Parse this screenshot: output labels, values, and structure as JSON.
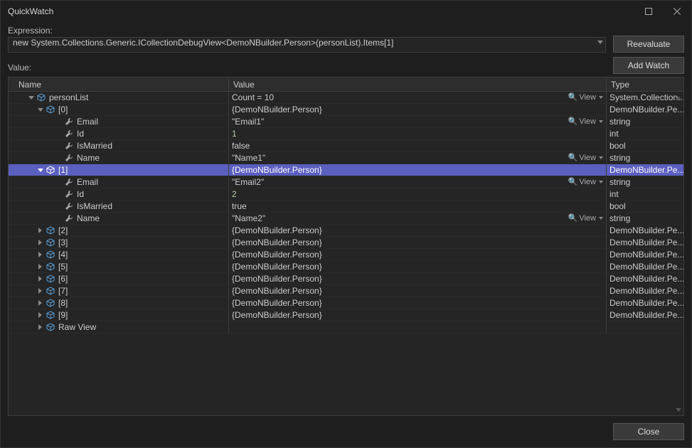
{
  "window": {
    "title": "QuickWatch"
  },
  "labels": {
    "expression": "Expression:",
    "value": "Value:"
  },
  "buttons": {
    "reevaluate": "Reevaluate",
    "addwatch": "Add Watch",
    "close": "Close"
  },
  "expression": "new System.Collections.Generic.ICollectionDebugView<DemoNBuilder.Person>(personList).Items[1]",
  "columns": {
    "name": "Name",
    "value": "Value",
    "type": "Type"
  },
  "viewText": "View",
  "rows": [
    {
      "indent": 2,
      "twist": "expanded",
      "icon": "cube",
      "name": "personList",
      "value": "Count = 10",
      "type": "System.Collection...",
      "view": true
    },
    {
      "indent": 3,
      "twist": "expanded",
      "icon": "cube",
      "name": "[0]",
      "value": "{DemoNBuilder.Person}",
      "type": "DemoNBuilder.Pe..."
    },
    {
      "indent": 5,
      "twist": "none",
      "icon": "wrench",
      "name": "Email",
      "value": "\"Email1\"",
      "type": "string",
      "view": true
    },
    {
      "indent": 5,
      "twist": "none",
      "icon": "wrench",
      "name": "Id",
      "value": "1",
      "type": "int",
      "numeric": true
    },
    {
      "indent": 5,
      "twist": "none",
      "icon": "wrench",
      "name": "IsMarried",
      "value": "false",
      "type": "bool"
    },
    {
      "indent": 5,
      "twist": "none",
      "icon": "wrench",
      "name": "Name",
      "value": "\"Name1\"",
      "type": "string",
      "view": true
    },
    {
      "indent": 3,
      "twist": "expanded",
      "icon": "cube",
      "name": "[1]",
      "value": "{DemoNBuilder.Person}",
      "type": "DemoNBuilder.Pe...",
      "selected": true
    },
    {
      "indent": 5,
      "twist": "none",
      "icon": "wrench",
      "name": "Email",
      "value": "\"Email2\"",
      "type": "string",
      "view": true
    },
    {
      "indent": 5,
      "twist": "none",
      "icon": "wrench",
      "name": "Id",
      "value": "2",
      "type": "int",
      "numeric": true
    },
    {
      "indent": 5,
      "twist": "none",
      "icon": "wrench",
      "name": "IsMarried",
      "value": "true",
      "type": "bool"
    },
    {
      "indent": 5,
      "twist": "none",
      "icon": "wrench",
      "name": "Name",
      "value": "\"Name2\"",
      "type": "string",
      "view": true
    },
    {
      "indent": 3,
      "twist": "collapsed",
      "icon": "cube",
      "name": "[2]",
      "value": "{DemoNBuilder.Person}",
      "type": "DemoNBuilder.Pe..."
    },
    {
      "indent": 3,
      "twist": "collapsed",
      "icon": "cube",
      "name": "[3]",
      "value": "{DemoNBuilder.Person}",
      "type": "DemoNBuilder.Pe..."
    },
    {
      "indent": 3,
      "twist": "collapsed",
      "icon": "cube",
      "name": "[4]",
      "value": "{DemoNBuilder.Person}",
      "type": "DemoNBuilder.Pe..."
    },
    {
      "indent": 3,
      "twist": "collapsed",
      "icon": "cube",
      "name": "[5]",
      "value": "{DemoNBuilder.Person}",
      "type": "DemoNBuilder.Pe..."
    },
    {
      "indent": 3,
      "twist": "collapsed",
      "icon": "cube",
      "name": "[6]",
      "value": "{DemoNBuilder.Person}",
      "type": "DemoNBuilder.Pe..."
    },
    {
      "indent": 3,
      "twist": "collapsed",
      "icon": "cube",
      "name": "[7]",
      "value": "{DemoNBuilder.Person}",
      "type": "DemoNBuilder.Pe..."
    },
    {
      "indent": 3,
      "twist": "collapsed",
      "icon": "cube",
      "name": "[8]",
      "value": "{DemoNBuilder.Person}",
      "type": "DemoNBuilder.Pe..."
    },
    {
      "indent": 3,
      "twist": "collapsed",
      "icon": "cube",
      "name": "[9]",
      "value": "{DemoNBuilder.Person}",
      "type": "DemoNBuilder.Pe..."
    },
    {
      "indent": 3,
      "twist": "collapsed",
      "icon": "cube",
      "name": "Raw View",
      "value": "",
      "type": ""
    }
  ]
}
